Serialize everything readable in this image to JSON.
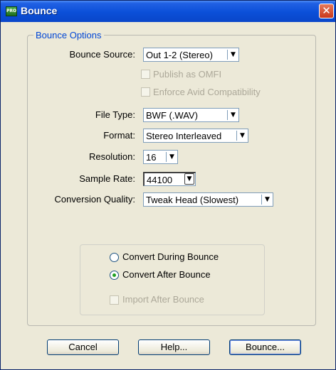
{
  "window": {
    "title": "Bounce",
    "close_glyph": "✕",
    "app_icon_text": "PRO"
  },
  "group": {
    "title": "Bounce Options"
  },
  "fields": {
    "bounce_source": {
      "label": "Bounce Source:",
      "value": "Out 1-2 (Stereo)"
    },
    "publish_omfi": {
      "label": "Publish as OMFI",
      "checked": false,
      "enabled": false
    },
    "enforce_avid": {
      "label": "Enforce Avid Compatibility",
      "checked": false,
      "enabled": false
    },
    "file_type": {
      "label": "File Type:",
      "value": "BWF (.WAV)"
    },
    "format": {
      "label": "Format:",
      "value": "Stereo Interleaved"
    },
    "resolution": {
      "label": "Resolution:",
      "value": "16"
    },
    "sample_rate": {
      "label": "Sample Rate:",
      "value": "44100"
    },
    "conversion_quality": {
      "label": "Conversion Quality:",
      "value": "Tweak Head (Slowest)"
    }
  },
  "conversion": {
    "during": {
      "label": "Convert During Bounce",
      "selected": false
    },
    "after": {
      "label": "Convert After Bounce",
      "selected": true
    },
    "import_after": {
      "label": "Import After Bounce",
      "checked": false,
      "enabled": false
    }
  },
  "buttons": {
    "cancel": "Cancel",
    "help": "Help...",
    "bounce": "Bounce..."
  },
  "icons": {
    "dropdown": "chevron-down-icon",
    "dropdown_glyph": "▼"
  },
  "colors": {
    "titlebar": "#0a46c9",
    "group_title": "#0046d5",
    "radio_dot": "#21a121",
    "disabled_text": "#aca899"
  }
}
